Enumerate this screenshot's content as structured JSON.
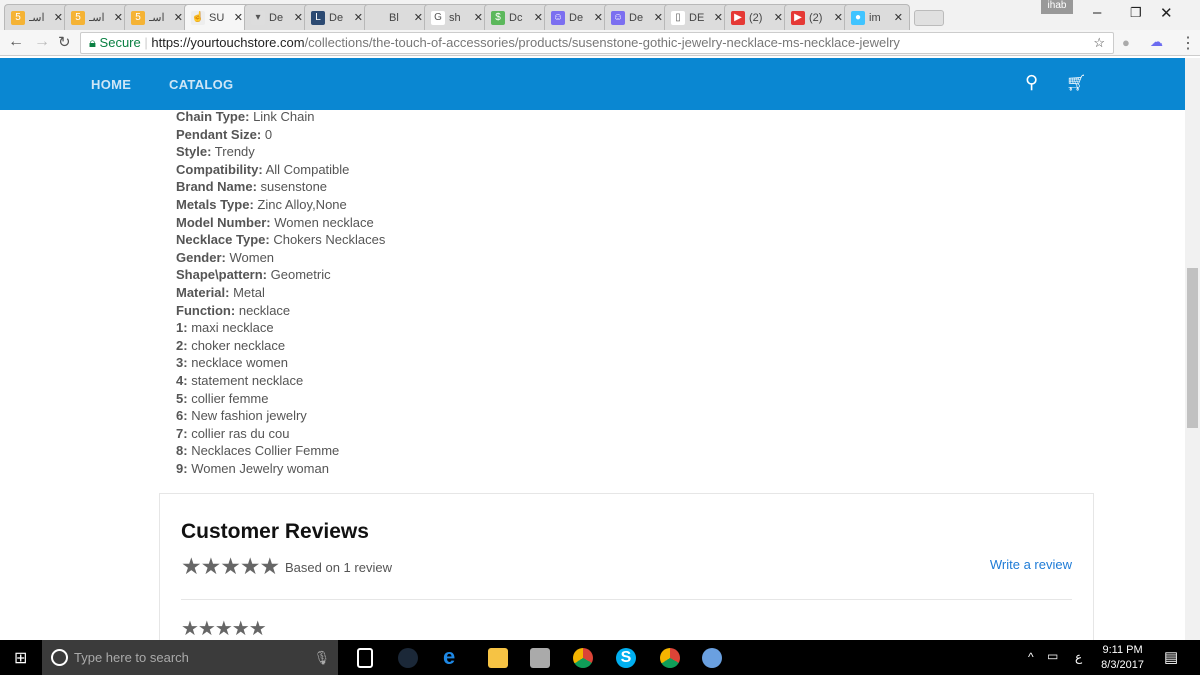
{
  "browser": {
    "tabs": [
      {
        "title": "اسـ",
        "fav": "5",
        "color": "#f5b335"
      },
      {
        "title": "اسـ",
        "fav": "5",
        "color": "#f5b335"
      },
      {
        "title": "اسـ",
        "fav": "5",
        "color": "#f5b335"
      },
      {
        "title": "SU",
        "fav": "☝",
        "color": "#eee",
        "active": true
      },
      {
        "title": "De",
        "fav": "▾",
        "color": "#ddd"
      },
      {
        "title": "De",
        "fav": "L",
        "color": "#2c4a72"
      },
      {
        "title": "Bl",
        "fav": "",
        "color": "#dcdcdc"
      },
      {
        "title": "sh",
        "fav": "G",
        "color": "#fff"
      },
      {
        "title": "Dc",
        "fav": "$",
        "color": "#5cb85c"
      },
      {
        "title": "De",
        "fav": "☺",
        "color": "#7b6ff0"
      },
      {
        "title": "De",
        "fav": "☺",
        "color": "#7b6ff0"
      },
      {
        "title": "DE",
        "fav": "▯",
        "color": "#fff"
      },
      {
        "title": "(2)",
        "fav": "▶",
        "color": "#e53935"
      },
      {
        "title": "(2)",
        "fav": "▶",
        "color": "#e53935"
      },
      {
        "title": "im",
        "fav": "●",
        "color": "#40c4ff"
      }
    ],
    "user": "ihab",
    "secure": "Secure",
    "url_host": "https://yourtouchstore.com",
    "url_path": "/collections/the-touch-of-accessories/products/susenstone-gothic-jewelry-necklace-ms-necklace-jewelry"
  },
  "nav": {
    "home": "HOME",
    "catalog": "CATALOG"
  },
  "specs": [
    {
      "label": "Chain Type:",
      "value": "Link Chain"
    },
    {
      "label": "Pendant Size:",
      "value": "0"
    },
    {
      "label": "Style:",
      "value": "Trendy"
    },
    {
      "label": "Compatibility:",
      "value": "All Compatible"
    },
    {
      "label": "Brand Name:",
      "value": "susenstone"
    },
    {
      "label": "Metals Type:",
      "value": "Zinc Alloy,None"
    },
    {
      "label": "Model Number:",
      "value": "Women necklace"
    },
    {
      "label": "Necklace Type:",
      "value": "Chokers Necklaces"
    },
    {
      "label": "Gender:",
      "value": "Women"
    },
    {
      "label": "Shape\\pattern:",
      "value": "Geometric"
    },
    {
      "label": "Material:",
      "value": "Metal"
    },
    {
      "label": "Function:",
      "value": "necklace"
    },
    {
      "label": "1:",
      "value": "maxi necklace"
    },
    {
      "label": "2:",
      "value": "choker necklace"
    },
    {
      "label": "3:",
      "value": "necklace women"
    },
    {
      "label": "4:",
      "value": "statement necklace"
    },
    {
      "label": "5:",
      "value": "collier femme"
    },
    {
      "label": "6:",
      "value": "New fashion jewelry"
    },
    {
      "label": "7:",
      "value": "collier ras du cou"
    },
    {
      "label": "8:",
      "value": "Necklaces Collier Femme"
    },
    {
      "label": "9:",
      "value": "Women Jewelry woman"
    }
  ],
  "reviews": {
    "title": "Customer Reviews",
    "rating": 5,
    "stars": "★★★★★",
    "based": "Based on 1 review",
    "write": "Write a review"
  },
  "taskbar": {
    "search_placeholder": "Type here to search",
    "time": "9:11 PM",
    "date": "8/3/2017",
    "lang": "ع"
  }
}
